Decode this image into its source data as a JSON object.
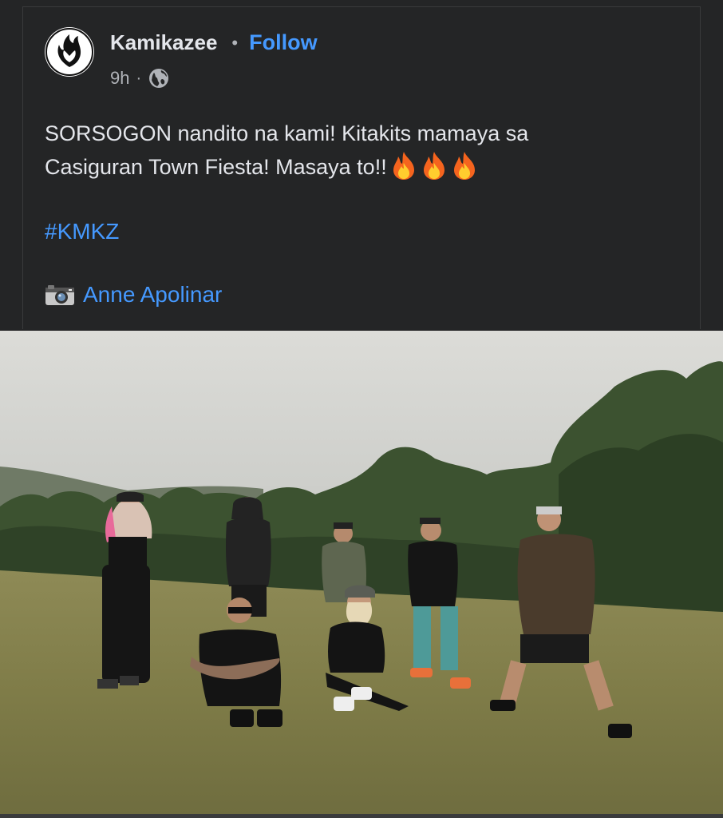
{
  "post": {
    "author": "Kamikazee",
    "separator": "•",
    "follow_label": "Follow",
    "time": "9h",
    "meta_separator": "·",
    "audience_icon": "globe-icon",
    "text_line1": "SORSOGON nandito na kami! Kitakits mamaya sa",
    "text_line2": "Casiguran Town Fiesta! Masaya to!!",
    "hashtag": "#KMKZ",
    "credit_icon": "camera-icon",
    "credit_name": "Anne Apolinar"
  },
  "photo": {
    "subject": "band-members-group-photo"
  },
  "colors": {
    "background": "#242526",
    "text": "#e4e6eb",
    "link": "#4599ff",
    "muted": "#b0b3b8"
  }
}
